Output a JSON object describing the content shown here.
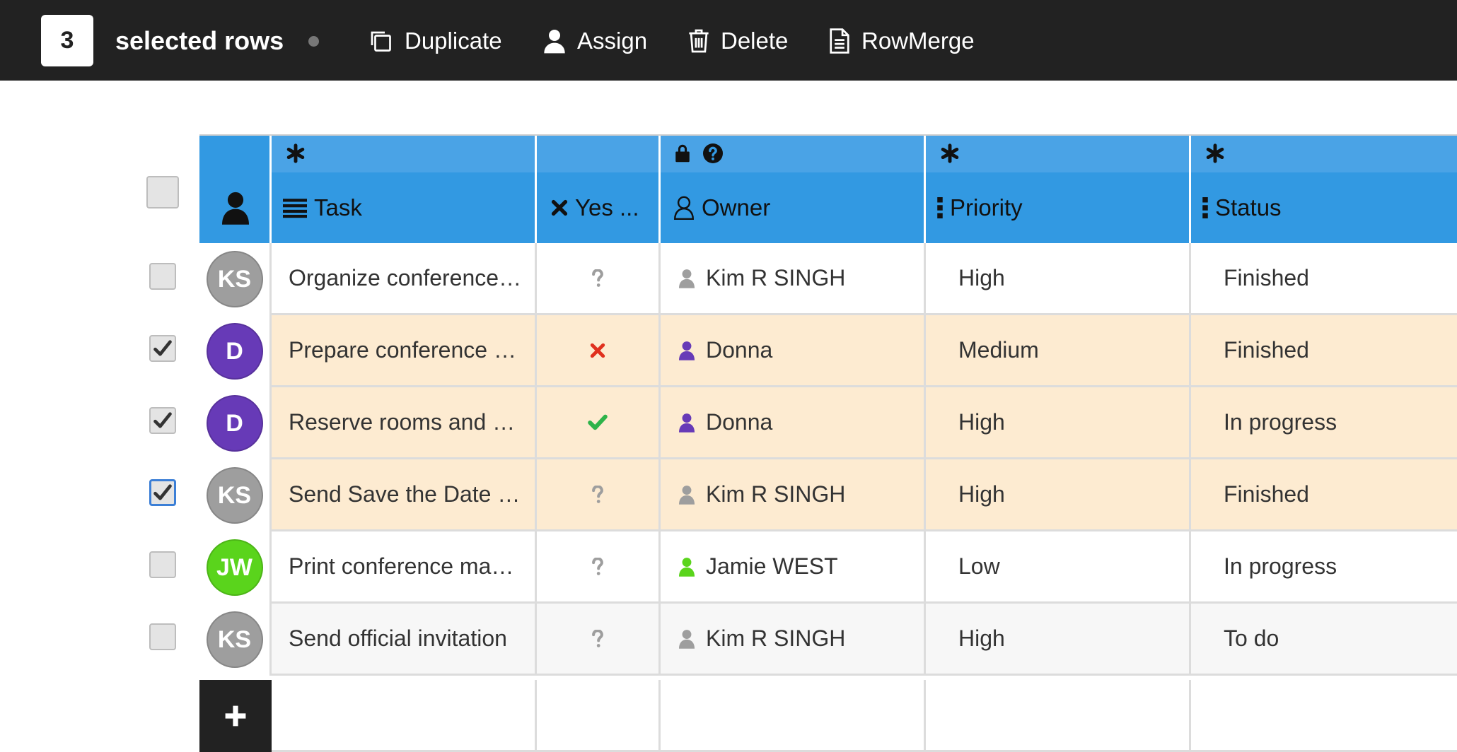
{
  "toolbar": {
    "selected_count": "3",
    "selected_label": "selected rows",
    "actions": [
      {
        "label": "Duplicate",
        "icon": "duplicate-icon"
      },
      {
        "label": "Assign",
        "icon": "user-icon"
      },
      {
        "label": "Delete",
        "icon": "trash-icon"
      },
      {
        "label": "RowMerge",
        "icon": "document-icon"
      }
    ]
  },
  "grid": {
    "columns": [
      {
        "label": "Task",
        "icon": "list-icon",
        "top_icon": "asterisk-icon"
      },
      {
        "label": "Yes ...",
        "icon": "x-icon",
        "top_icon": ""
      },
      {
        "label": "Owner",
        "icon": "user-outline-icon",
        "top_icon": "lock-help-icons"
      },
      {
        "label": "Priority",
        "icon": "vertical-dots-icon",
        "top_icon": "asterisk-icon"
      },
      {
        "label": "Status",
        "icon": "vertical-dots-icon",
        "top_icon": "asterisk-icon"
      }
    ],
    "rows": [
      {
        "initials": "KS",
        "avatar_color": "#9e9e9e",
        "task": "Organize conference…",
        "yes": "unknown",
        "owner": "Kim R SINGH",
        "owner_color": "#9e9e9e",
        "priority": "High",
        "status": "Finished",
        "checked": false
      },
      {
        "initials": "D",
        "avatar_color": "#673ab7",
        "task": "Prepare conference …",
        "yes": "no",
        "owner": "Donna",
        "owner_color": "#673ab7",
        "priority": "Medium",
        "status": "Finished",
        "checked": true
      },
      {
        "initials": "D",
        "avatar_color": "#673ab7",
        "task": "Reserve rooms and …",
        "yes": "yes",
        "owner": "Donna",
        "owner_color": "#673ab7",
        "priority": "High",
        "status": "In progress",
        "checked": true
      },
      {
        "initials": "KS",
        "avatar_color": "#9e9e9e",
        "task": "Send Save the Date …",
        "yes": "unknown",
        "owner": "Kim R SINGH",
        "owner_color": "#9e9e9e",
        "priority": "High",
        "status": "Finished",
        "checked": true
      },
      {
        "initials": "JW",
        "avatar_color": "#5ad41c",
        "task": "Print conference ma…",
        "yes": "unknown",
        "owner": "Jamie WEST",
        "owner_color": "#5ad41c",
        "priority": "Low",
        "status": "In progress",
        "checked": false
      },
      {
        "initials": "KS",
        "avatar_color": "#9e9e9e",
        "task": "Send official invitation",
        "yes": "unknown",
        "owner": "Kim R SINGH",
        "owner_color": "#9e9e9e",
        "priority": "High",
        "status": "To do",
        "checked": false
      }
    ]
  },
  "colors": {
    "header_top": "#4aa3e6",
    "header_main": "#3299e2",
    "selected_row": "#fdebd1",
    "toolbar_bg": "#222222",
    "no_mark": "#e0301e",
    "yes_mark": "#2eb34a"
  }
}
